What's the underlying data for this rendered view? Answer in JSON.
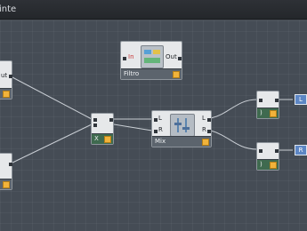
{
  "window": {
    "title": "inte"
  },
  "nodes": {
    "left_top": {
      "port_label": "ut"
    },
    "left_bottom": {
      "port_label": ""
    },
    "filtro": {
      "in_label": "In",
      "out_label": "Out",
      "title": "Filtro"
    },
    "x_node": {
      "title": "X"
    },
    "mix": {
      "left_in": "L",
      "right_in": "R",
      "left_out": "L",
      "right_out": "R",
      "title": "Mix"
    },
    "out_top": {
      "glyph": ")"
    },
    "out_bottom": {
      "glyph": ")"
    },
    "tab_top": {
      "label": "L"
    },
    "tab_bottom": {
      "label": "R"
    }
  },
  "colors": {
    "accent_orange": "#f1b33b",
    "output_blue": "#5d86c4",
    "canvas": "#454c55"
  }
}
